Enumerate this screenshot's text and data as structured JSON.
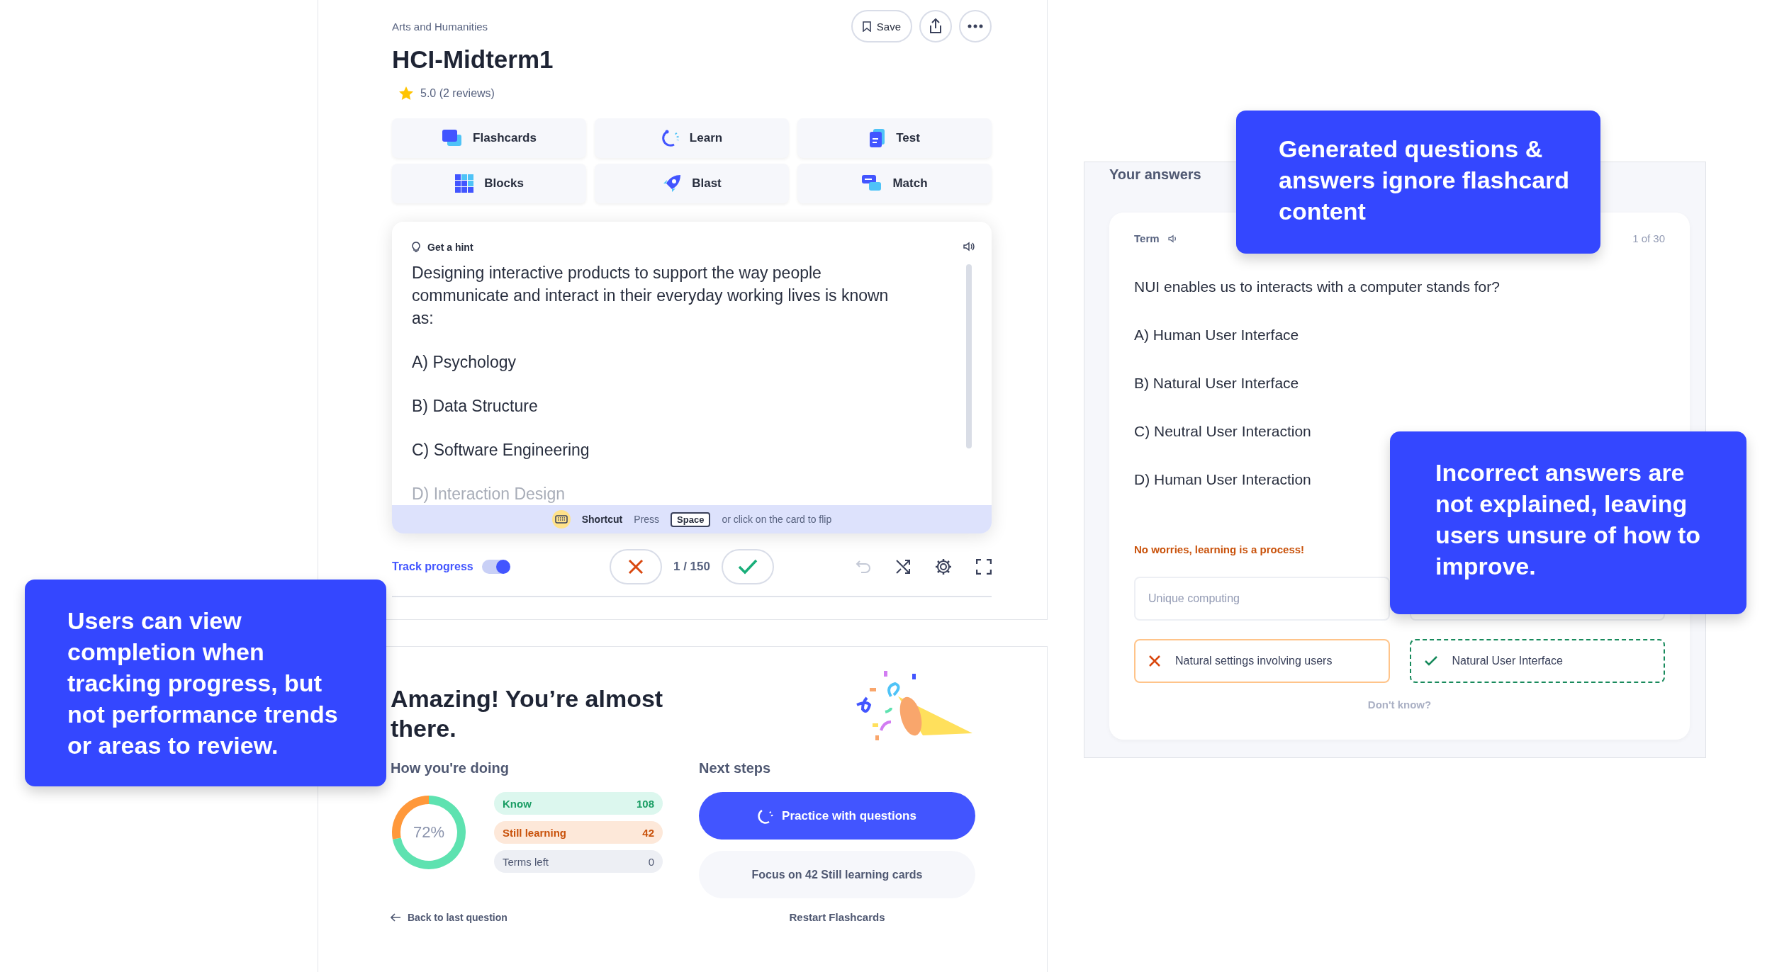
{
  "study_set": {
    "category": "Arts and Humanities",
    "title": "HCI-Midterm1",
    "rating": "5.0 (2 reviews)",
    "actions": [
      {
        "kind": "save",
        "label": "Save"
      },
      {
        "kind": "share"
      },
      {
        "kind": "more"
      }
    ],
    "modes": [
      {
        "kind": "flashcards",
        "label": "Flashcards"
      },
      {
        "kind": "learn",
        "label": "Learn"
      },
      {
        "kind": "test",
        "label": "Test"
      },
      {
        "kind": "blocks",
        "label": "Blocks"
      },
      {
        "kind": "blast",
        "label": "Blast"
      },
      {
        "kind": "match",
        "label": "Match"
      }
    ],
    "card": {
      "hint": "Get a hint",
      "question": "Designing interactive products to support the way people communicate and interact in their everyday working lives is known as:",
      "options": [
        "A) Psychology",
        "B) Data Structure",
        "C) Software Engineering",
        "D) Interaction Design"
      ],
      "shortcut": {
        "label": "Shortcut",
        "press": "Press",
        "key": "Space",
        "text": "or click on the card to flip"
      }
    },
    "controls": {
      "track_label": "Track progress",
      "track_progress": true,
      "counter": "1 / 150"
    }
  },
  "results": {
    "title": "Amazing! You’re almost there.",
    "doing_title": "How you're doing",
    "percent": "72%",
    "chart_data": {
      "type": "donut",
      "values": [
        72,
        28
      ]
    },
    "stats": [
      {
        "kind": "know",
        "label": "Know",
        "count": "108"
      },
      {
        "kind": "learning",
        "label": "Still learning",
        "count": "42"
      },
      {
        "kind": "left",
        "label": "Terms left",
        "count": "0"
      }
    ],
    "next_title": "Next steps",
    "primary": "Practice with questions",
    "secondary": "Focus on 42 Still learning cards",
    "back": "Back to last question",
    "restart": "Restart Flashcards"
  },
  "quiz": {
    "title": "Your answers",
    "term_label": "Term",
    "position": "1 of 30",
    "question": "NUI enables us to interacts with a computer stands for?",
    "options": [
      "A) Human User Interface",
      "B) Natural User Interface",
      "C) Neutral User Interaction",
      "D) Human User Interaction"
    ],
    "feedback": "No worries, learning is a process!",
    "choices": [
      {
        "kind": "field",
        "placeholder": "Unique computing"
      },
      {
        "kind": "field"
      },
      {
        "kind": "wrong",
        "text": "Natural settings involving users"
      },
      {
        "kind": "correct",
        "text": "Natural User Interface"
      }
    ],
    "dont_know": "Don't know?"
  },
  "callouts": [
    {
      "kind": "top",
      "text": "Generated questions & answers ignore flashcard content"
    },
    {
      "kind": "middle",
      "text": "Incorrect answers are not explained, leaving users unsure of how to improve."
    },
    {
      "kind": "left",
      "text": "Users can view completion when tracking progress, but not performance trends or areas to review."
    }
  ]
}
